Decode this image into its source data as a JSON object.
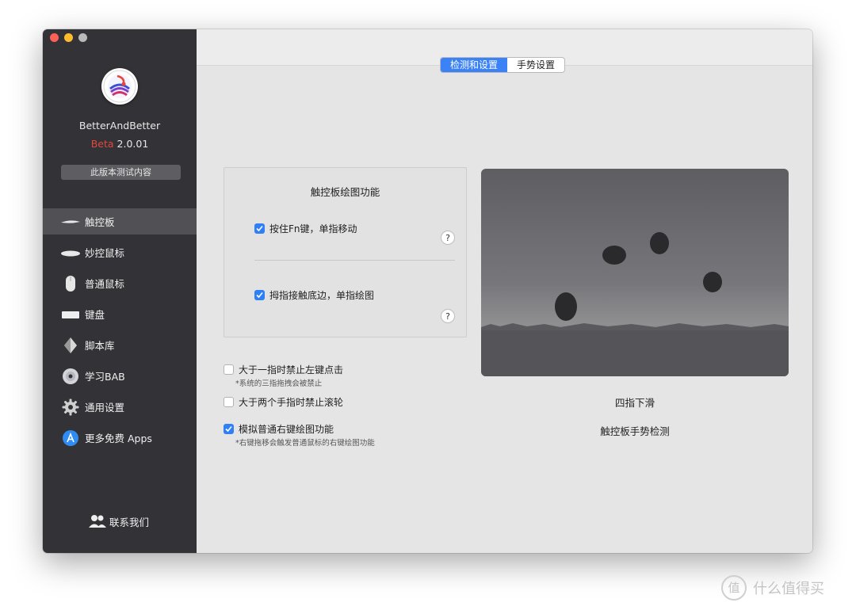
{
  "window": {
    "app_name": "BetterAndBetter",
    "beta_label": "Beta",
    "version": "2.0.01",
    "trial_button": "此版本测试内容"
  },
  "sidebar": {
    "items": [
      {
        "label": "触控板",
        "icon": "trackpad-icon",
        "active": true
      },
      {
        "label": "妙控鼠标",
        "icon": "magic-mouse-icon"
      },
      {
        "label": "普通鼠标",
        "icon": "mouse-icon"
      },
      {
        "label": "键盘",
        "icon": "keyboard-icon"
      },
      {
        "label": "脚本库",
        "icon": "script-icon"
      },
      {
        "label": "学习BAB",
        "icon": "dvd-icon"
      },
      {
        "label": "通用设置",
        "icon": "gear-icon"
      },
      {
        "label": "更多免费 Apps",
        "icon": "app-store-icon"
      }
    ],
    "contact": "联系我们"
  },
  "tabs": [
    {
      "label": "检测和设置",
      "selected": true
    },
    {
      "label": "手势设置",
      "selected": false
    }
  ],
  "drawing_panel": {
    "title": "触控板绘图功能",
    "option1": {
      "label": "按住Fn键，单指移动",
      "checked": true,
      "help": "?"
    },
    "option2": {
      "label": "拇指接触底边，单指绘图",
      "checked": true,
      "help": "?"
    }
  },
  "options": {
    "disable_left_click": {
      "label": "大于一指时禁止左键点击",
      "note": "*系统的三指拖拽会被禁止",
      "checked": false
    },
    "disable_scroll": {
      "label": "大于两个手指时禁止滚轮",
      "checked": false
    },
    "simulate_right_drawing": {
      "label": "模拟普通右键绘图功能",
      "note": "*右键拖移会触发普通鼠标的右键绘图功能",
      "checked": true
    }
  },
  "preview": {
    "gesture_name": "四指下滑",
    "detect_label": "触控板手势检测"
  },
  "watermark": {
    "symbol": "值",
    "text": "什么值得买"
  },
  "colors": {
    "accent": "#3b82f6",
    "sidebar_bg": "#333337",
    "beta": "#e0483e"
  }
}
